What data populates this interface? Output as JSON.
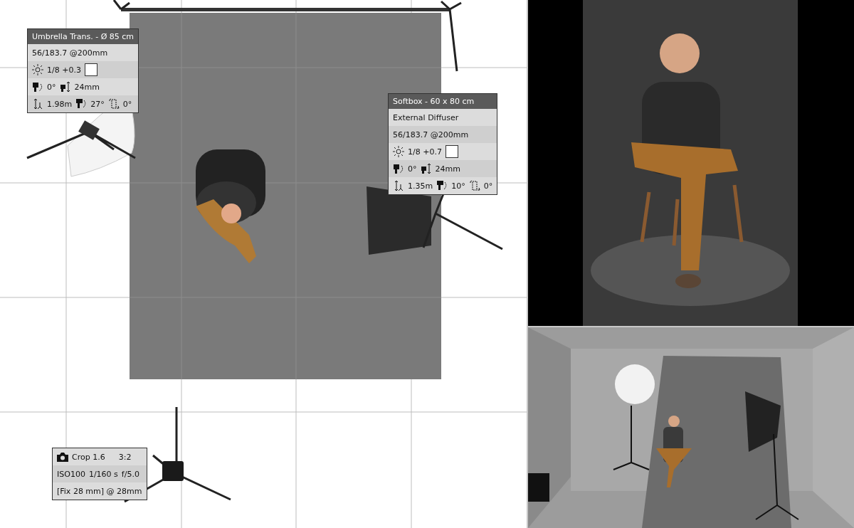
{
  "plan": {
    "lights": [
      {
        "kind": "umbrella",
        "title": "Umbrella Trans. - Ø 85 cm",
        "power": "56/183.7 @200mm",
        "flash": "1/8 +0.3",
        "color": "#ffffff",
        "rotation": "0°",
        "zoom": "24mm",
        "height": "1.98m",
        "tilt": "27°",
        "roll": "0°"
      },
      {
        "kind": "softbox",
        "title": "Softbox - 60 x 80 cm",
        "modifier": "External Diffuser",
        "power": "56/183.7 @200mm",
        "flash": "1/8 +0.7",
        "color": "#ffffff",
        "rotation": "0°",
        "zoom": "24mm",
        "height": "1.35m",
        "tilt": "10°",
        "roll": "0°"
      }
    ],
    "camera": {
      "crop": "Crop 1.6",
      "ratio": "3:2",
      "iso": "ISO100",
      "shutter": "1/160 s",
      "aperture": "f/5.0",
      "lens": "[Fix 28 mm] @ 28mm"
    }
  }
}
